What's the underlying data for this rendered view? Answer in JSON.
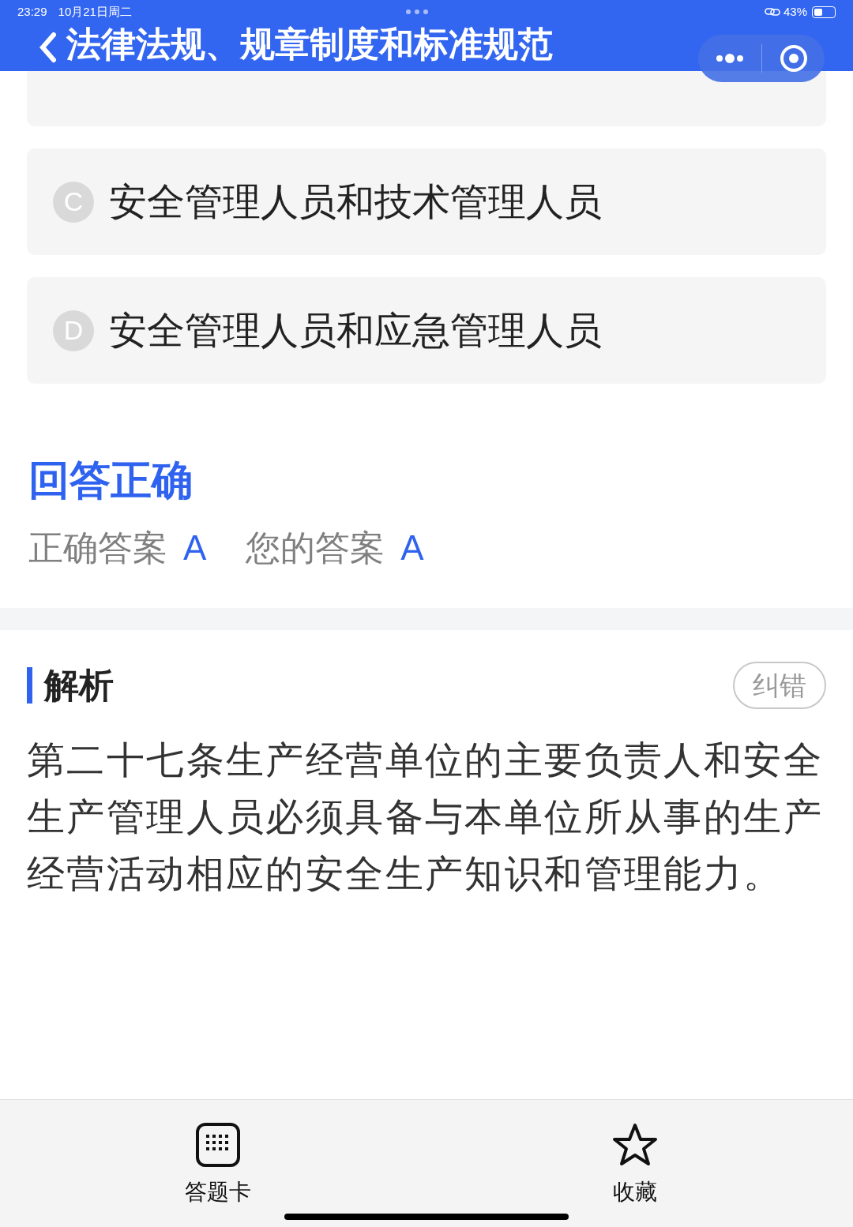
{
  "status_bar": {
    "time": "23:29",
    "date": "10月21日周二",
    "battery": "43%"
  },
  "header": {
    "title": "法律法规、规章制度和标准规范"
  },
  "options": [
    {
      "letter": "C",
      "text": "安全管理人员和技术管理人员"
    },
    {
      "letter": "D",
      "text": "安全管理人员和应急管理人员"
    }
  ],
  "result": {
    "title": "回答正确",
    "correct_label": "正确答案",
    "correct_value": "A",
    "your_label": "您的答案",
    "your_value": "A"
  },
  "analysis": {
    "title": "解析",
    "report_button": "纠错",
    "text": "第二十七条生产经营单位的主要负责人和安全生产管理人员必须具备与本单位所从事的生产经营活动相应的安全生产知识和管理能力。"
  },
  "bottom_bar": [
    {
      "kind": "grid",
      "label": "答题卡"
    },
    {
      "kind": "star",
      "label": "收藏"
    }
  ]
}
